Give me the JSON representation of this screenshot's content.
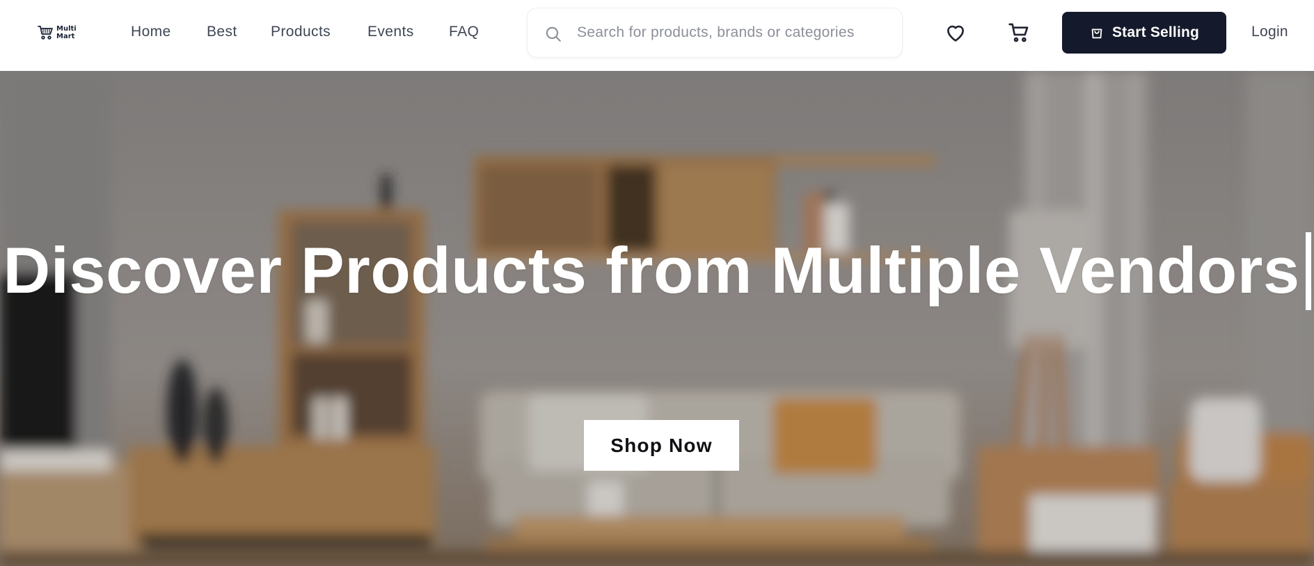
{
  "brand": {
    "logo_icon": "shopping-cart-logo",
    "name_line1": "Multi",
    "name_line2": "Mart"
  },
  "nav": {
    "links": [
      "Home",
      "Best",
      "Products",
      "Events",
      "FAQ"
    ]
  },
  "search": {
    "icon": "search-icon",
    "placeholder": "Search for products, brands or categories",
    "value": ""
  },
  "header_actions": {
    "wishlist_icon": "heart-icon",
    "cart_icon": "cart-icon",
    "sell_icon": "shopping-bag-icon",
    "sell_label": "Start Selling",
    "login_label": "Login"
  },
  "hero": {
    "title": "Discover Products from Multiple Vendors",
    "cta_label": "Shop Now"
  },
  "colors": {
    "primary_dark": "#141a2b",
    "nav_text": "#3f4654",
    "hero_text": "#ffffff"
  }
}
